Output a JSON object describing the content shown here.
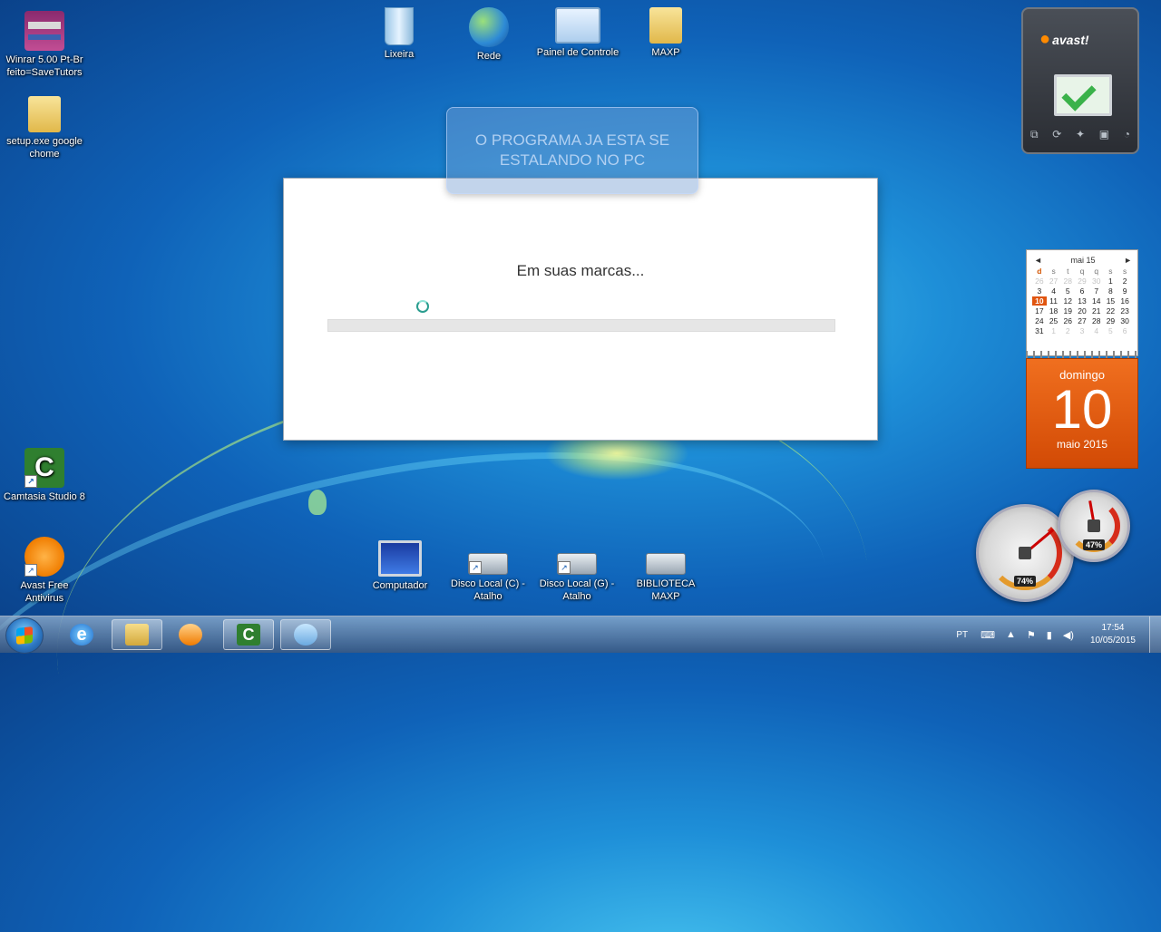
{
  "desktop_icons": [
    {
      "label": "Winrar 5.00 Pt-Br feito=SaveTutors",
      "icon": "winrar-icon"
    },
    {
      "label": "setup.exe google chome",
      "icon": "folder-icon"
    },
    {
      "label": "Lixeira",
      "icon": "recycle-bin-icon"
    },
    {
      "label": "Rede",
      "icon": "network-globe-icon"
    },
    {
      "label": "Painel de Controle",
      "icon": "control-panel-icon"
    },
    {
      "label": "MAXP",
      "icon": "user-folder-icon"
    },
    {
      "label": "Camtasia Studio 8",
      "icon": "camtasia-icon"
    },
    {
      "label": "Avast Free Antivirus",
      "icon": "avast-icon"
    },
    {
      "label": "Computador",
      "icon": "computer-icon"
    },
    {
      "label": "Disco Local (C) - Atalho",
      "icon": "drive-icon"
    },
    {
      "label": "Disco Local (G) - Atalho",
      "icon": "drive-icon"
    },
    {
      "label": "BIBLIOTECA MAXP",
      "icon": "drive-icon"
    }
  ],
  "overlay_note": "O PROGRAMA JA ESTA SE ESTALANDO NO PC",
  "installer": {
    "message": "Em suas marcas...",
    "progress": 0
  },
  "avast_gadget": {
    "logo": "avast!"
  },
  "calendar": {
    "month_label": "mai 15",
    "prev": "◄",
    "next": "►",
    "weekdays": [
      "d",
      "s",
      "t",
      "q",
      "q",
      "s",
      "s"
    ],
    "days": [
      [
        "26",
        "27",
        "28",
        "29",
        "30",
        "1",
        "2"
      ],
      [
        "3",
        "4",
        "5",
        "6",
        "7",
        "8",
        "9"
      ],
      [
        "10",
        "11",
        "12",
        "13",
        "14",
        "15",
        "16"
      ],
      [
        "17",
        "18",
        "19",
        "20",
        "21",
        "22",
        "23"
      ],
      [
        "24",
        "25",
        "26",
        "27",
        "28",
        "29",
        "30"
      ],
      [
        "31",
        "1",
        "2",
        "3",
        "4",
        "5",
        "6"
      ]
    ],
    "today": "10",
    "day_name": "domingo",
    "day_number": "10",
    "month_year": "maio 2015"
  },
  "meters": {
    "cpu_percent": "74%",
    "memory_percent": "47%"
  },
  "taskbar": {
    "language": "PT",
    "time": "17:54",
    "date": "10/05/2015"
  },
  "colors": {
    "accent_orange": "#e0550f",
    "progress_fill": "#4aa3df"
  }
}
